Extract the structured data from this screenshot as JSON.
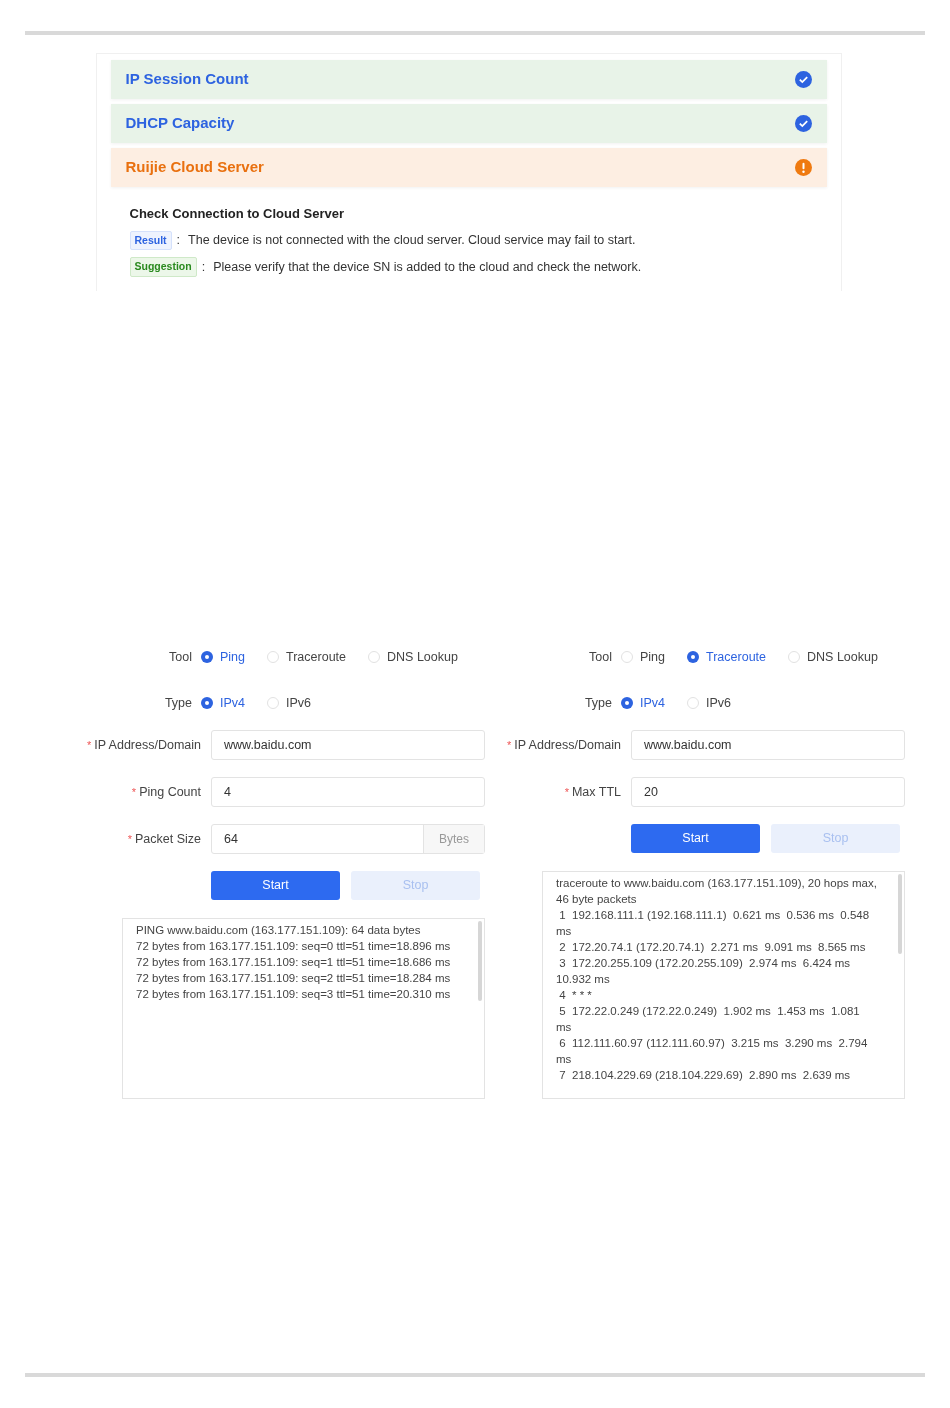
{
  "diagnosis": {
    "items": [
      {
        "title": "IP Session Count",
        "kind": "pass"
      },
      {
        "title": "DHCP Capacity",
        "kind": "pass"
      },
      {
        "title": "Ruijie Cloud Server",
        "kind": "warning",
        "detail": {
          "heading": "Check Connection to Cloud Server",
          "lines": [
            {
              "kind": "result",
              "tag": "Result",
              "separator": ":",
              "text": "The device is not connected with the cloud server. Cloud service may fail to start."
            },
            {
              "kind": "suggestion",
              "tag": "Suggestion",
              "separator": ":",
              "text": "Please verify that the device SN is added to the cloud and check the network."
            }
          ]
        }
      }
    ]
  },
  "panels": [
    {
      "tool_label": "Tool",
      "tools": [
        {
          "label": "Ping",
          "selected": true
        },
        {
          "label": "Traceroute",
          "selected": false
        },
        {
          "label": "DNS Lookup",
          "selected": false
        }
      ],
      "type_label": "Type",
      "types": [
        {
          "label": "IPv4",
          "selected": true
        },
        {
          "label": "IPv6",
          "selected": false
        }
      ],
      "fields": [
        {
          "mark": "*",
          "label": "IP Address/Domain",
          "value": "www.baidu.com"
        },
        {
          "mark": "*",
          "label": "Ping Count",
          "value": "4"
        },
        {
          "mark": "*",
          "label": "Packet Size",
          "value": "64",
          "suffix": "Bytes"
        }
      ],
      "start": {
        "label": "Start",
        "disabled": false
      },
      "stop": {
        "label": "Stop",
        "disabled": true
      },
      "output": [
        "PING www.baidu.com (163.177.151.109): 64 data bytes",
        "72 bytes from 163.177.151.109: seq=0 ttl=51 time=18.896 ms",
        "72 bytes from 163.177.151.109: seq=1 ttl=51 time=18.686 ms",
        "72 bytes from 163.177.151.109: seq=2 ttl=51 time=18.284 ms",
        "72 bytes from 163.177.151.109: seq=3 ttl=51 time=20.310 ms"
      ]
    },
    {
      "tool_label": "Tool",
      "tools": [
        {
          "label": "Ping",
          "selected": false
        },
        {
          "label": "Traceroute",
          "selected": true
        },
        {
          "label": "DNS Lookup",
          "selected": false
        }
      ],
      "type_label": "Type",
      "types": [
        {
          "label": "IPv4",
          "selected": true
        },
        {
          "label": "IPv6",
          "selected": false
        }
      ],
      "fields": [
        {
          "mark": "*",
          "label": "IP Address/Domain",
          "value": "www.baidu.com"
        },
        {
          "mark": "*",
          "label": "Max TTL",
          "value": "20"
        }
      ],
      "start": {
        "label": "Start",
        "disabled": false
      },
      "stop": {
        "label": "Stop",
        "disabled": true
      },
      "output": [
        "traceroute to www.baidu.com (163.177.151.109), 20 hops max, 46 byte packets",
        " 1  192.168.111.1 (192.168.111.1)  0.621 ms  0.536 ms  0.548 ms",
        " 2  172.20.74.1 (172.20.74.1)  2.271 ms  9.091 ms  8.565 ms",
        " 3  172.20.255.109 (172.20.255.109)  2.974 ms  6.424 ms  10.932 ms",
        " 4  * * *",
        " 5  172.22.0.249 (172.22.0.249)  1.902 ms  1.453 ms  1.081 ms",
        " 6  112.111.60.97 (112.111.60.97)  3.215 ms  3.290 ms  2.794 ms",
        " 7  218.104.229.69 (218.104.229.69)  2.890 ms  2.639 ms"
      ]
    }
  ]
}
